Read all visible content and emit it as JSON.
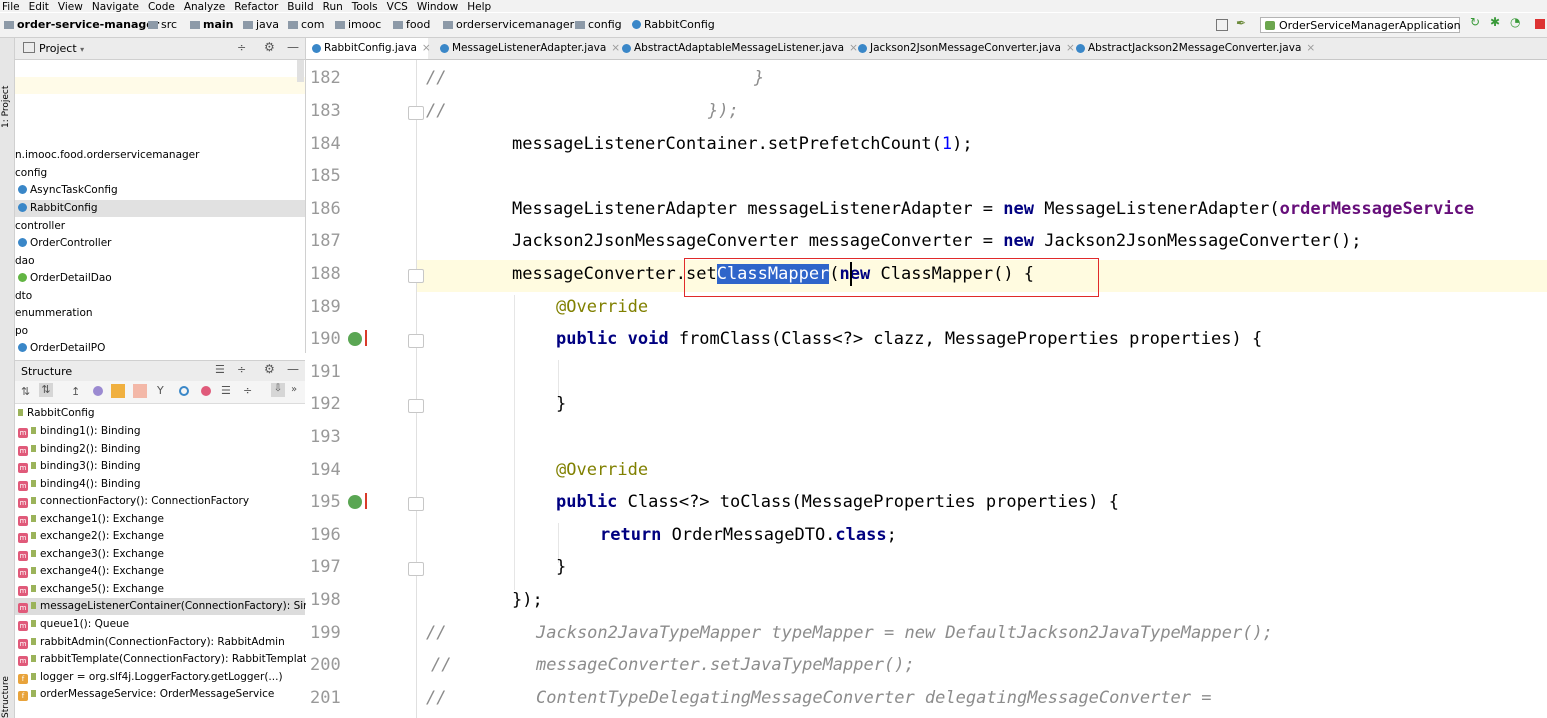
{
  "menu": [
    "File",
    "Edit",
    "View",
    "Navigate",
    "Code",
    "Analyze",
    "Refactor",
    "Build",
    "Run",
    "Tools",
    "VCS",
    "Window",
    "Help"
  ],
  "breadcrumb": [
    "order-service-manager",
    "src",
    "main",
    "java",
    "com",
    "imooc",
    "food",
    "orderservicemanager",
    "config",
    "RabbitConfig"
  ],
  "run_config": "OrderServiceManagerApplication",
  "project_panel": {
    "title": "Project",
    "stripe_label": "1: Project",
    "items": [
      {
        "label": "n.imooc.food.orderservicemanager",
        "icon": "package"
      },
      {
        "label": "config",
        "icon": "package"
      },
      {
        "label": "AsyncTaskConfig",
        "icon": "class"
      },
      {
        "label": "RabbitConfig",
        "icon": "class",
        "selected": true
      },
      {
        "label": "controller",
        "icon": "package"
      },
      {
        "label": "OrderController",
        "icon": "class"
      },
      {
        "label": "dao",
        "icon": "package"
      },
      {
        "label": "OrderDetailDao",
        "icon": "interface"
      },
      {
        "label": "dto",
        "icon": "package"
      },
      {
        "label": "enummeration",
        "icon": "package"
      },
      {
        "label": "po",
        "icon": "package"
      },
      {
        "label": "OrderDetailPO",
        "icon": "class"
      }
    ]
  },
  "structure_panel": {
    "title": "Structure",
    "stripe_label": "Structure",
    "root": "RabbitConfig",
    "items": [
      {
        "label": "binding1(): Binding",
        "kind": "m"
      },
      {
        "label": "binding2(): Binding",
        "kind": "m"
      },
      {
        "label": "binding3(): Binding",
        "kind": "m"
      },
      {
        "label": "binding4(): Binding",
        "kind": "m"
      },
      {
        "label": "connectionFactory(): ConnectionFactory",
        "kind": "m"
      },
      {
        "label": "exchange1(): Exchange",
        "kind": "m"
      },
      {
        "label": "exchange2(): Exchange",
        "kind": "m"
      },
      {
        "label": "exchange3(): Exchange",
        "kind": "m"
      },
      {
        "label": "exchange4(): Exchange",
        "kind": "m"
      },
      {
        "label": "exchange5(): Exchange",
        "kind": "m"
      },
      {
        "label": "messageListenerContainer(ConnectionFactory): Simple",
        "kind": "m",
        "selected": true
      },
      {
        "label": "queue1(): Queue",
        "kind": "m"
      },
      {
        "label": "rabbitAdmin(ConnectionFactory): RabbitAdmin",
        "kind": "m"
      },
      {
        "label": "rabbitTemplate(ConnectionFactory): RabbitTemplate",
        "kind": "m"
      },
      {
        "label": "logger = org.slf4j.LoggerFactory.getLogger(...)",
        "kind": "f"
      },
      {
        "label": "orderMessageService: OrderMessageService",
        "kind": "f"
      }
    ]
  },
  "tabs": [
    {
      "label": "RabbitConfig.java",
      "active": true
    },
    {
      "label": "MessageListenerAdapter.java"
    },
    {
      "label": "AbstractAdaptableMessageListener.java"
    },
    {
      "label": "Jackson2JsonMessageConverter.java"
    },
    {
      "label": "AbstractJackson2MessageConverter.java"
    }
  ],
  "line_numbers": [
    "182",
    "183",
    "184",
    "185",
    "186",
    "187",
    "188",
    "189",
    "190",
    "191",
    "192",
    "193",
    "194",
    "195",
    "196",
    "197",
    "198",
    "199",
    "200",
    "201"
  ],
  "code": {
    "l182_c": "//",
    "l182_b": "}",
    "l183_c": "//",
    "l183_b": "});",
    "l184_a": "messageListenerContainer.setPrefetchCount(",
    "l184_n": "1",
    "l184_z": ");",
    "l186_a": "MessageListenerAdapter messageListenerAdapter = ",
    "l186_k": "new",
    "l186_b": " MessageListenerAdapter(",
    "l186_f": "orderMessageService",
    "l187_a": "Jackson2JsonMessageConverter messageConverter = ",
    "l187_k": "new",
    "l187_b": " Jackson2JsonMessageConverter();",
    "l188_a": "messageConverter.set",
    "l188_s": "ClassMapper",
    "l188_b": "(",
    "l188_k": "new",
    "l188_c": " ClassMapper() {",
    "l189": "@Override",
    "l190_k": "public void",
    "l190_b": " fromClass(Class<?> clazz, MessageProperties properties) {",
    "l192": "}",
    "l194": "@Override",
    "l195_k": "public",
    "l195_b": " Class<?> toClass(MessageProperties properties) {",
    "l196_k": "return",
    "l196_b": " OrderMessageDTO.",
    "l196_k2": "class",
    "l196_z": ";",
    "l197": "}",
    "l198": "});",
    "l199_c": "//",
    "l199_t": "Jackson2JavaTypeMapper typeMapper = new DefaultJackson2JavaTypeMapper();",
    "l200_c": "//",
    "l200_t": "messageConverter.setJavaTypeMapper();",
    "l201_c": "//",
    "l201_t": "ContentTypeDelegatingMessageConverter delegatingMessageConverter ="
  },
  "colors": {
    "keyword": "#000080",
    "annotation": "#808000",
    "field": "#660e7a",
    "number": "#0000ff",
    "comment": "#8c8c8c",
    "selection": "#2f65ca",
    "highlight_box": "#e02a2a"
  }
}
